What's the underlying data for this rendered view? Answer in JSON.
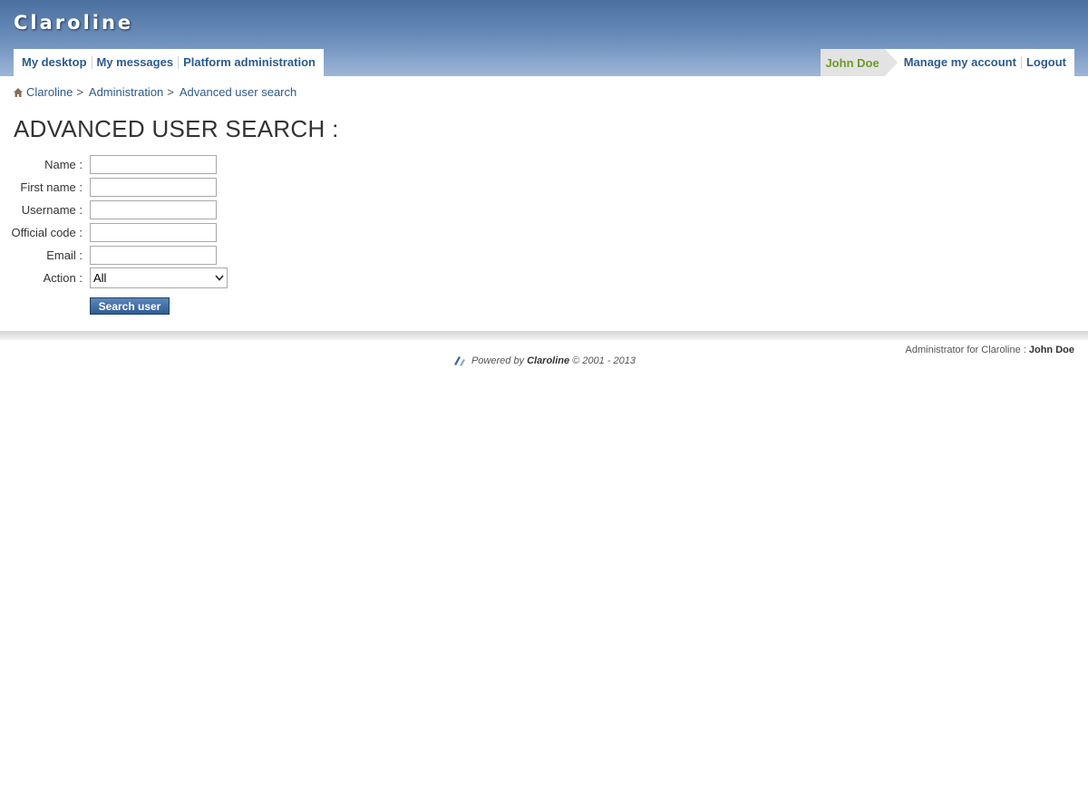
{
  "header": {
    "site_title": "Claroline"
  },
  "nav": {
    "left": [
      "My desktop",
      "My messages",
      "Platform administration"
    ],
    "user": "John Doe",
    "right": [
      "Manage my account",
      "Logout"
    ]
  },
  "breadcrumb": {
    "items": [
      "Claroline",
      "Administration",
      "Advanced user search"
    ],
    "separator": ">"
  },
  "page": {
    "title": "ADVANCED USER SEARCH :"
  },
  "form": {
    "fields": [
      {
        "label": "Name :",
        "value": ""
      },
      {
        "label": "First name :",
        "value": ""
      },
      {
        "label": "Username :",
        "value": ""
      },
      {
        "label": "Official code :",
        "value": ""
      },
      {
        "label": "Email :",
        "value": ""
      }
    ],
    "action": {
      "label": "Action :",
      "selected": "All"
    },
    "submit_label": "Search user"
  },
  "footer": {
    "admin_prefix": "Administrator for Claroline :",
    "admin_name": "John Doe",
    "powered_prefix": "Powered by",
    "powered_brand": "Claroline",
    "powered_suffix": "© 2001 - 2013"
  },
  "colors": {
    "header_top": "#4a70a0",
    "link": "#2c5a8c",
    "user_name": "#6b9c2a",
    "button": "#2f5c94"
  },
  "icons": [
    "home-icon",
    "chevron-down-icon",
    "claroline-logo-icon"
  ]
}
